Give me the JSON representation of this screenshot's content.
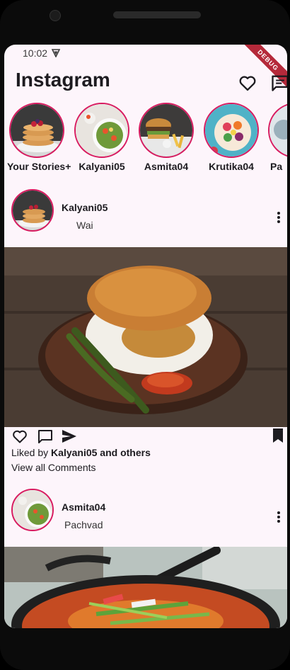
{
  "status": {
    "time": "10:02",
    "debug_banner": "DEBUG"
  },
  "appbar": {
    "title": "Instagram"
  },
  "stories": [
    {
      "label": "Your Stories+"
    },
    {
      "label": "Kalyani05"
    },
    {
      "label": "Asmita04"
    },
    {
      "label": "Krutika04"
    },
    {
      "label": "Pa"
    }
  ],
  "posts": [
    {
      "username": "Kalyani05",
      "location": "Wai",
      "liked_by_prefix": "Liked by ",
      "liked_by_user": "Kalyani05 and others",
      "view_comments": "View all Comments"
    },
    {
      "username": "Asmita04",
      "location": "Pachvad"
    }
  ],
  "colors": {
    "accent": "#d81b60",
    "background": "#fdf5fb",
    "text": "#1d1b20"
  }
}
